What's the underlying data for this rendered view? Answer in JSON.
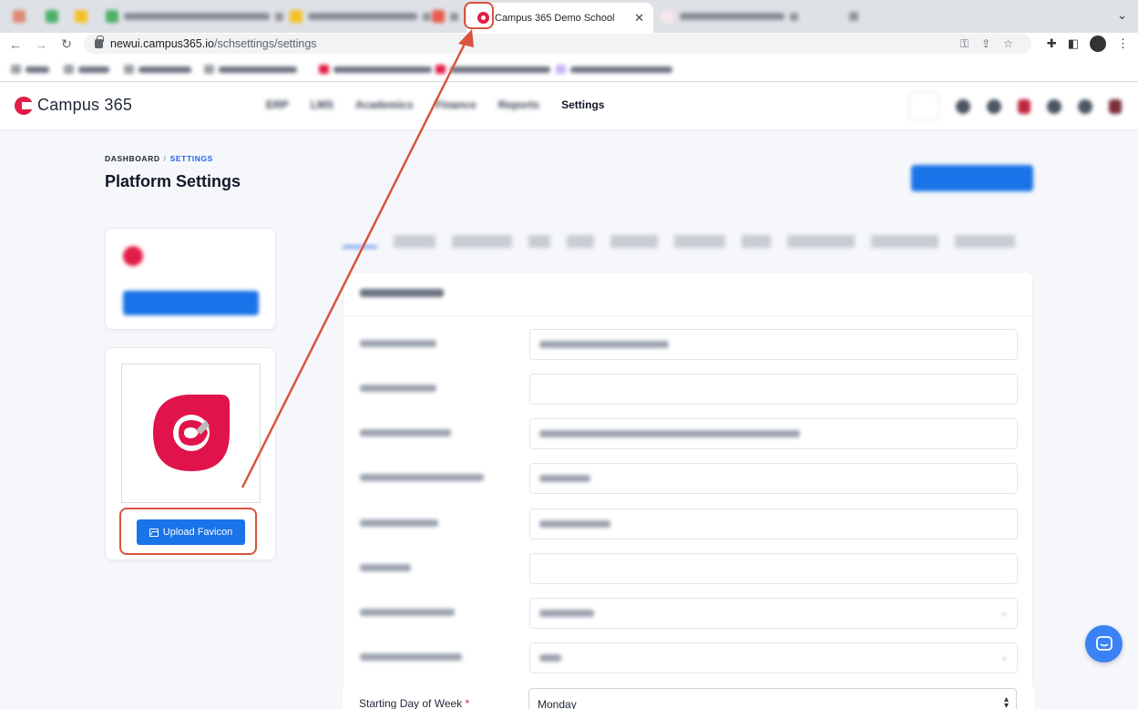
{
  "browser": {
    "active_tab_title": "Campus 365 Demo School",
    "active_tab_close": "✕",
    "url_host": "newui.campus365.io",
    "url_path": "/schsettings/settings",
    "nav_back": "←",
    "nav_forward": "→",
    "nav_reload": "↻",
    "tab_menu_chevron": "⌄"
  },
  "app": {
    "brand_name": "Campus 365",
    "nav_active": "Settings",
    "nav_blurred": [
      "ERP",
      "LMS",
      "Academics",
      "Finance",
      "Reports"
    ]
  },
  "page": {
    "breadcrumb_root": "DASHBOARD",
    "breadcrumb_sep": "/",
    "breadcrumb_current": "SETTINGS",
    "title": "Platform Settings"
  },
  "favicon_card": {
    "upload_label": "Upload Favicon"
  },
  "form": {
    "starting_day_label": "Starting Day of Week",
    "required_mark": "*",
    "starting_day_value": "Monday",
    "select_arrows": "⌃⌄"
  },
  "colors": {
    "brand": "#e11d48",
    "primary": "#1a73e8",
    "annotation": "#d9533f"
  }
}
